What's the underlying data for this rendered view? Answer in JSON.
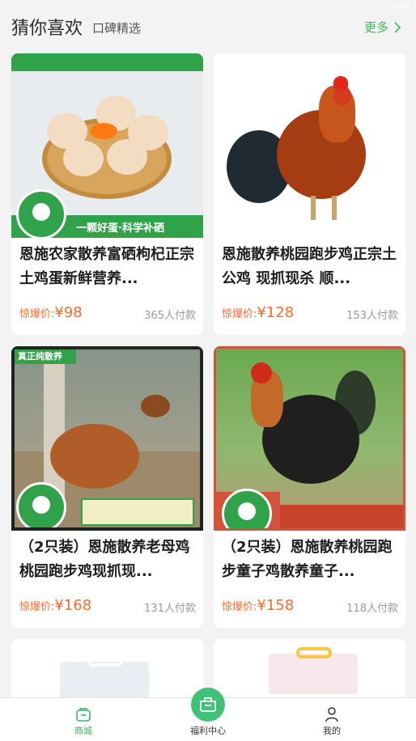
{
  "header": {
    "title": "猜你喜欢",
    "subtitle": "口碑精选",
    "more": "更多",
    "status_time": "2:09"
  },
  "image_text": {
    "egg_banner": "一颗好蛋·科学补硒",
    "hen_tag": "真正纯散养"
  },
  "products": [
    {
      "name": "恩施农家散养富硒枸杞正宗土鸡蛋新鲜营养...",
      "price_label": "惊爆价:",
      "price": "¥98",
      "sold_num": "365",
      "sold_unit": "人付款"
    },
    {
      "name": "恩施散养桃园跑步鸡正宗土公鸡 现抓现杀 顺...",
      "price_label": "惊爆价:",
      "price": "¥128",
      "sold_num": "153",
      "sold_unit": "人付款"
    },
    {
      "name": "（2只装）恩施散养老母鸡桃园跑步鸡现抓现...",
      "price_label": "惊爆价:",
      "price": "¥168",
      "sold_num": "131",
      "sold_unit": "人付款"
    },
    {
      "name": "（2只装）恩施散养桃园跑步童子鸡散养童子...",
      "price_label": "惊爆价:",
      "price": "¥158",
      "sold_num": "118",
      "sold_unit": "人付款"
    }
  ],
  "tabs": [
    {
      "label": "商城",
      "active": true
    },
    {
      "label": "福利中心",
      "active": false
    },
    {
      "label": "我的",
      "active": false
    }
  ],
  "colors": {
    "accent": "#3fb65f",
    "price": "#ff6a2a"
  }
}
